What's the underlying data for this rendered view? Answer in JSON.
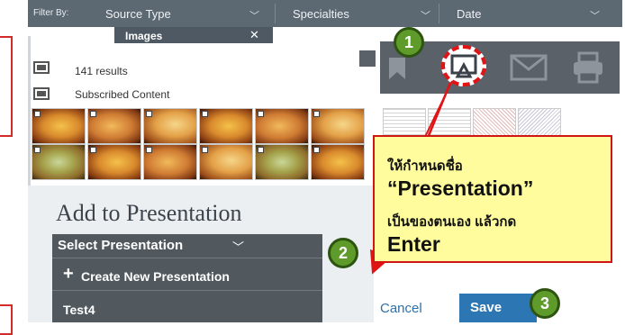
{
  "filter_bar": {
    "label": "Filter By:",
    "columns": [
      "Source Type",
      "Specialties",
      "Date"
    ],
    "chip_label": "Images",
    "chip_close": "✕"
  },
  "results": {
    "count_text": "141 results",
    "subscribed_text": "Subscribed Content"
  },
  "toolbar": {
    "icons": [
      "bookmark-icon",
      "presentation-icon",
      "email-icon",
      "print-icon"
    ]
  },
  "callout": {
    "line1": "ให้กำหนดชื่อ",
    "line2": "“Presentation”",
    "line3": "เป็นของตนเอง แล้วกด",
    "line4": "Enter"
  },
  "badges": [
    "1",
    "2",
    "3"
  ],
  "panel": {
    "title": "Add to Presentation",
    "select_label": "Select Presentation",
    "create_label": "Create New Presentation",
    "items": [
      "Test4"
    ],
    "cancel_label": "Cancel",
    "save_label": "Save"
  },
  "colors": {
    "annotation_red": "#e01414",
    "badge_green": "#5f9b2a",
    "callout_yellow": "#fefc9c",
    "save_blue": "#2d76b4"
  }
}
